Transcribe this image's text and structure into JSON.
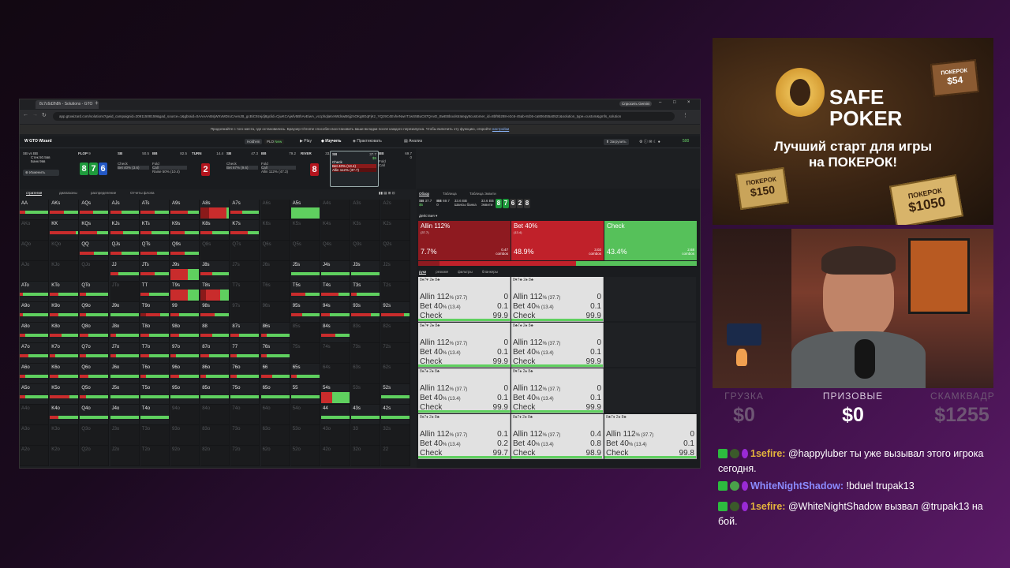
{
  "browser": {
    "tab_label": "8c7c6d2h8h - Solutions - GTO",
    "profile": "Спросить Gemini",
    "url": "app.gtowizard.com/solutions?gwid_campaignid=20911508159&gad_source=1&gbraid=0AAAAABsjWXvMDruCAenJB_gcBiC9zejdj8gclid=CjwKCAjwfv5BhAvEiwA_vccphqlaKeWtdswB6jjznOKg8GqFjKz_YQz9C4EvheNwnTzwS5BuC87QAvD_BwEBboolstrategy8customer_id=8bf9b288-e2c6-45ab-8cb5-ca806455a0521&solution_type=custom&gmfs_solution",
    "notice": "Продолжайте с того места, где остановились. Браузер Chrome способен восстановить ваши вкладки после каждого перезапуска. Чтобы включить эту функцию, откройте",
    "notice_link": "настройки"
  },
  "app": {
    "logo": "GTO Wizard",
    "holdem": "Hold'em",
    "plo": "PLO",
    "plo_badge": "New",
    "nav": [
      "Play",
      "Изучить",
      "Практиковать",
      "Анализ"
    ],
    "upload": "Загрузить",
    "coins": "500"
  },
  "spot": {
    "title": "SB vs BB",
    "stack": "Стек 50.5вв",
    "bounty": "Банк 9вв",
    "change": "Изменить"
  },
  "streets": [
    {
      "pos": "FLOP",
      "val": "9"
    },
    {
      "pos": "SB",
      "val": "50.5",
      "line1": "Check",
      "line2": "Bet 40%",
      "line2v": "(3.6)"
    },
    {
      "pos": "BB",
      "val": "82.5",
      "line1": "Fold",
      "line2": "Call",
      "line3": "Raise 50%",
      "line3v": "(10.4)"
    },
    {
      "pos": "TURN",
      "val": "14.4"
    },
    {
      "pos": "SB",
      "val": "47.3",
      "line1": "Check",
      "line2": "Bet 67%",
      "line2v": "(9.6)"
    },
    {
      "pos": "BB",
      "val": "79.2",
      "line1": "Fold",
      "line2": "Call",
      "line3": "Allin 112%",
      "line3v": "(47.3)"
    },
    {
      "pos": "RIVER",
      "val": "33.6"
    },
    {
      "pos": "SB",
      "val": "37.7",
      "sub": "$5",
      "line1": "Check",
      "line2": "Bet 40%",
      "line2v": "(13.4)",
      "line3": "Allin 112%",
      "line3v": "(37.7)"
    },
    {
      "pos": "BB",
      "val": "69.7",
      "sub": "0",
      "line1": "Fold",
      "line2": "Call"
    }
  ],
  "board_flop": [
    "8",
    "7",
    "6"
  ],
  "board_turn": "2",
  "board_river": "8",
  "subtabs": [
    "стратегия",
    "диапазоны",
    "распределение",
    "Отчеты флопа"
  ],
  "grid_rows": [
    [
      "AA",
      "AKs",
      "AQs",
      "AJs",
      "ATs",
      "A9s",
      "A8s",
      "A7s",
      "A6s",
      "A5s",
      "A4s",
      "A3s",
      "A2s"
    ],
    [
      "AKo",
      "KK",
      "KQs",
      "KJs",
      "KTs",
      "K9s",
      "K8s",
      "K7s",
      "K6s",
      "K5s",
      "K4s",
      "K3s",
      "K2s"
    ],
    [
      "AQo",
      "KQo",
      "QQ",
      "QJs",
      "QTs",
      "Q9s",
      "Q8s",
      "Q7s",
      "Q6s",
      "Q5s",
      "Q4s",
      "Q3s",
      "Q2s"
    ],
    [
      "AJo",
      "KJo",
      "QJo",
      "JJ",
      "JTs",
      "J9s",
      "J8s",
      "J7s",
      "J6s",
      "J5s",
      "J4s",
      "J3s",
      "J2s"
    ],
    [
      "ATo",
      "KTo",
      "QTo",
      "JTo",
      "TT",
      "T9s",
      "T8s",
      "T7s",
      "T6s",
      "T5s",
      "T4s",
      "T3s",
      "T2s"
    ],
    [
      "A9o",
      "K9o",
      "Q9o",
      "J9o",
      "T9o",
      "99",
      "98s",
      "97s",
      "96s",
      "95s",
      "94s",
      "93s",
      "92s"
    ],
    [
      "A8o",
      "K8o",
      "Q8o",
      "J8o",
      "T8o",
      "98o",
      "88",
      "87s",
      "86s",
      "85s",
      "84s",
      "83s",
      "82s"
    ],
    [
      "A7o",
      "K7o",
      "Q7o",
      "J7o",
      "T7o",
      "97o",
      "87o",
      "77",
      "76s",
      "75s",
      "74s",
      "73s",
      "72s"
    ],
    [
      "A6o",
      "K6o",
      "Q6o",
      "J6o",
      "T6o",
      "96o",
      "86o",
      "76o",
      "66",
      "65s",
      "64s",
      "63s",
      "62s"
    ],
    [
      "A5o",
      "K5o",
      "Q5o",
      "J5o",
      "T5o",
      "95o",
      "85o",
      "75o",
      "65o",
      "55",
      "54s",
      "53s",
      "52s"
    ],
    [
      "A4o",
      "K4o",
      "Q4o",
      "J4o",
      "T4o",
      "94o",
      "84o",
      "74o",
      "64o",
      "54o",
      "44",
      "43s",
      "42s"
    ],
    [
      "A3o",
      "K3o",
      "Q3o",
      "J3o",
      "T3o",
      "93o",
      "83o",
      "73o",
      "63o",
      "53o",
      "43o",
      "33",
      "32s"
    ],
    [
      "A2o",
      "K2o",
      "Q2o",
      "J2o",
      "T2o",
      "92o",
      "82o",
      "72o",
      "62o",
      "52o",
      "42o",
      "32o",
      "22"
    ]
  ],
  "panel": {
    "tabs": [
      "Обзор",
      "Таблица",
      "Таблица Эквити"
    ],
    "summary": [
      {
        "pos": "SB",
        "val": "37.7",
        "sub": "$5"
      },
      {
        "pos": "BB",
        "val": "69.7",
        "sub": "0"
      },
      {
        "pos": "",
        "val": "33.6 BB",
        "sub": "Шансы банка"
      },
      {
        "pos": "",
        "val": "33.6 BB",
        "sub": "Эквити"
      }
    ],
    "board": [
      "8",
      "7",
      "6",
      "2",
      "8"
    ],
    "actions_label": "Действия",
    "actions": [
      {
        "name": "Allin 112%",
        "size": "(37.7)",
        "pct": "7.7%",
        "ev": "0.47",
        "ev_label": "combos",
        "color": "#8e1a20",
        "freq": 7.7
      },
      {
        "name": "Bet 40%",
        "size": "(13.4)",
        "pct": "48.9%",
        "ev": "3.02",
        "ev_label": "combos",
        "color": "#c0212a",
        "freq": 48.9
      },
      {
        "name": "Check",
        "size": "",
        "pct": "43.4%",
        "ev": "2.68",
        "ev_label": "combos",
        "color": "#56c15a",
        "freq": 43.4
      }
    ],
    "hand_tabs": [
      "руки",
      "резюме",
      "фильтры",
      "бланкеры"
    ],
    "hands": [
      {
        "combo": "8♦7♥ 2♠ 8♣",
        "a": "0",
        "b": "0.1",
        "c": "99.9"
      },
      {
        "combo": "8♥7♣ 2♠ 8♣",
        "a": "0",
        "b": "0.1",
        "c": "99.9"
      },
      {
        "combo": "8♠7♥ 2♠ 8♣",
        "a": "0",
        "b": "0.1",
        "c": "99.9"
      },
      {
        "combo": "8♣7♠ 2♠ 8♣",
        "a": "0",
        "b": "0.1",
        "c": "99.9"
      },
      {
        "combo": "8♦7♠ 2♠ 8♣",
        "a": "0",
        "b": "0.1",
        "c": "99.9"
      },
      {
        "combo": "8♥7♠ 2♠ 8♣",
        "a": "0",
        "b": "0.1",
        "c": "99.9"
      },
      {
        "combo": "8♦7♦ 2♠ 8♣",
        "a": "0.1",
        "b": "0.2",
        "c": "99.7"
      },
      {
        "combo": "8♠7♦ 2♠ 8♣",
        "a": "0.4",
        "b": "0.8",
        "c": "98.9"
      },
      {
        "combo": "8♣7♦ 2♠ 8♣",
        "a": "0",
        "b": "0.1",
        "c": "99.8"
      }
    ],
    "hand_rows": [
      "Allin",
      "112",
      "% (37.7)",
      "Bet 40",
      "% (13.4)",
      "Check"
    ]
  },
  "ad": {
    "brand1": "SAFE",
    "brand2": "POKER",
    "tagline1": "Лучший старт для игры",
    "tagline2": "на ПОКЕРОК!",
    "ticket1_title": "ПОКЕРОК",
    "ticket1_val": "$150",
    "ticket2_title": "ПОКЕРОК",
    "ticket2_val": "$1050",
    "ticket3_title": "ПОКЕРОК",
    "ticket3_val": "$54"
  },
  "prizes": {
    "left_title": "ГРУЗКА",
    "left_val": "$0",
    "mid_title": "ПРИЗОВЫЕ",
    "mid_val": "$0",
    "right_title": "СКАМКВАДР",
    "right_val": "$1255"
  },
  "chat": [
    {
      "user": "1sefire:",
      "text": "@happyluber ты уже вызывал этого игрока сегодня."
    },
    {
      "user": "WhiteNightShadow:",
      "text": "!bduel trupak13"
    },
    {
      "user": "1sefire:",
      "text": "@WhiteNightShadow вызвал @trupak13 на бой."
    }
  ],
  "colors": {
    "check": "#5fd05f",
    "bet": "#c92c2c",
    "allin": "#8a1a1a",
    "accent": "#1e9a3c"
  }
}
